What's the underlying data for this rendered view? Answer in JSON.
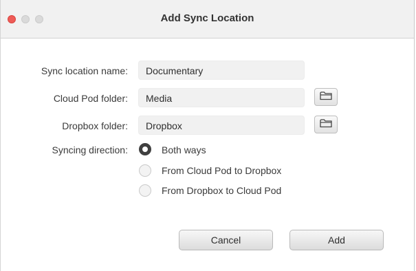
{
  "window": {
    "title": "Add Sync Location"
  },
  "form": {
    "name_label": "Sync location name:",
    "name_value": "Documentary",
    "cloud_label": "Cloud Pod folder:",
    "cloud_value": "Media",
    "dropbox_label": "Dropbox folder:",
    "dropbox_value": "Dropbox",
    "direction_label": "Syncing direction:",
    "options": [
      {
        "label": "Both ways",
        "selected": true
      },
      {
        "label": "From Cloud Pod to Dropbox",
        "selected": false
      },
      {
        "label": "From Dropbox to Cloud Pod",
        "selected": false
      }
    ]
  },
  "buttons": {
    "cancel": "Cancel",
    "add": "Add"
  },
  "icons": {
    "folder_browse": "folder-icon"
  },
  "colors": {
    "close": "#ee5b57",
    "selected_radio": "#3f3f3f"
  }
}
